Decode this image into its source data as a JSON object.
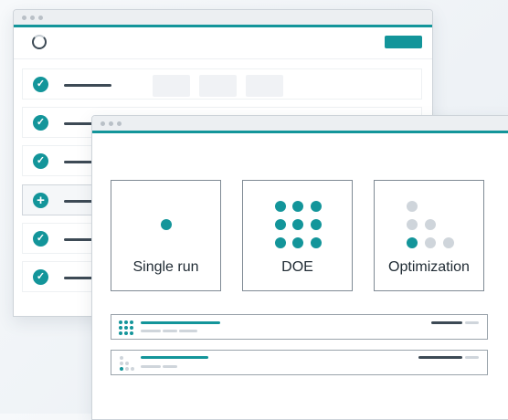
{
  "back_window": {
    "titlebar": {
      "dots": 3
    },
    "header": {
      "spinner_icon": "spinner-icon",
      "action_button_color": "#13959a"
    },
    "rows": [
      {
        "status_icon": "check-icon",
        "glyph": "✓",
        "status": "done"
      },
      {
        "status_icon": "check-icon",
        "glyph": "✓",
        "status": "done"
      },
      {
        "status_icon": "check-icon",
        "glyph": "✓",
        "status": "done"
      },
      {
        "status_icon": "plus-icon",
        "glyph": "+",
        "status": "add"
      },
      {
        "status_icon": "check-icon",
        "glyph": "✓",
        "status": "done"
      },
      {
        "status_icon": "check-icon",
        "glyph": "✓",
        "status": "done"
      }
    ]
  },
  "front_window": {
    "cards": [
      {
        "label": "Single run",
        "icon": "single-dot-icon"
      },
      {
        "label": "DOE",
        "icon": "dot-grid-icon"
      },
      {
        "label": "Optimization",
        "icon": "dot-staircase-icon"
      }
    ],
    "list": [
      {
        "icon": "dot-grid-small-icon"
      },
      {
        "icon": "dot-staircase-small-icon"
      }
    ]
  },
  "colors": {
    "accent": "#13959a",
    "dark_text": "#1f2a33",
    "placeholder_dark": "#3d4a55",
    "placeholder_light": "#cfd5db"
  }
}
